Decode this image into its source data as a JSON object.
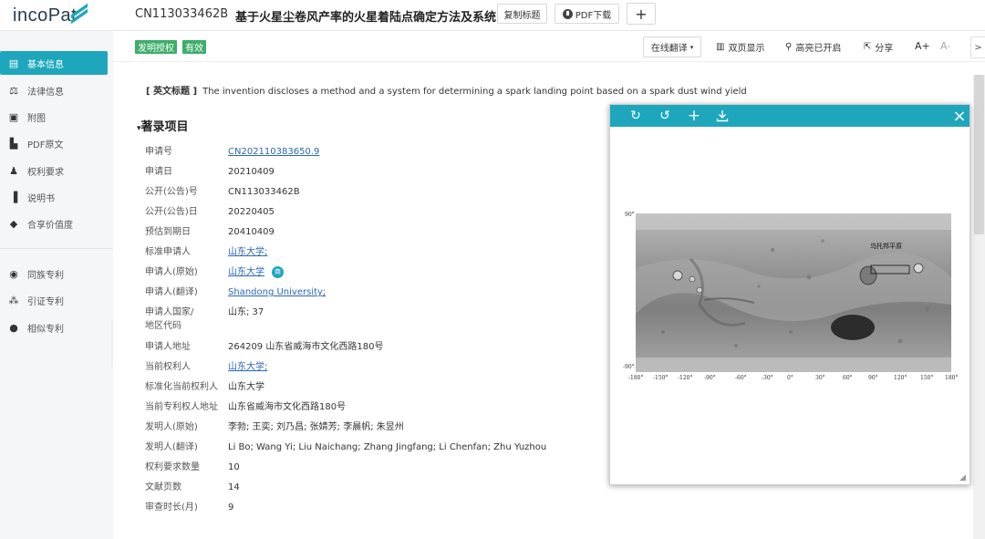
{
  "header": {
    "logo": "incoPat",
    "doc_id": "CN113033462B",
    "title": "基于火星尘卷风产率的火星着陆点确定方法及系统",
    "copy_title_label": "复制标题",
    "pdf_download_label": "PDF下载",
    "add_label": "+"
  },
  "sidebar": {
    "items": [
      {
        "label": "基本信息",
        "icon": "document-icon"
      },
      {
        "label": "法律信息",
        "icon": "scale-icon"
      },
      {
        "label": "附图",
        "icon": "image-icon"
      },
      {
        "label": "PDF原文",
        "icon": "pdf-icon"
      },
      {
        "label": "权利要求",
        "icon": "stamp-icon"
      },
      {
        "label": "说明书",
        "icon": "book-icon"
      },
      {
        "label": "合享价值度",
        "icon": "diamond-icon"
      },
      {
        "label": "同族专利",
        "icon": "family-icon"
      },
      {
        "label": "引证专利",
        "icon": "citation-icon"
      },
      {
        "label": "相似专利",
        "icon": "similar-icon"
      }
    ]
  },
  "toolbar": {
    "badge_grant": "发明授权",
    "badge_valid": "有效",
    "translate_label": "在线翻译",
    "dual_page_label": "双页显示",
    "highlight_label": "高亮已开启",
    "share_label": "分享",
    "font_up": "A+",
    "font_down": "A-",
    "edge": ">"
  },
  "english_title": {
    "label": "[ 英文标题 ]",
    "value": "The invention discloses a method and a system for determining a spark landing point based on a spark dust wind yield"
  },
  "section_title": "著录项目",
  "bibliographic": [
    {
      "label": "申请号",
      "value": "CN202110383650.9",
      "link": true
    },
    {
      "label": "申请日",
      "value": "20210409"
    },
    {
      "label": "公开(公告)号",
      "value": "CN113033462B"
    },
    {
      "label": "公开(公告)日",
      "value": "20220405"
    },
    {
      "label": "预估到期日",
      "value": "20410409"
    },
    {
      "label": "标准申请人",
      "value": "山东大学;",
      "link": true
    },
    {
      "label": "申请人(原始)",
      "value": "山东大学",
      "link": true,
      "tag": "商"
    },
    {
      "label": "申请人(翻译)",
      "value": "Shandong University;",
      "link": true
    },
    {
      "label": "申请人国家/地区代码",
      "value": "山东; 37"
    },
    {
      "label": "申请人地址",
      "value": "264209 山东省威海市文化西路180号"
    },
    {
      "label": "当前权利人",
      "value": "山东大学;",
      "link": true
    },
    {
      "label": "标准化当前权利人",
      "value": "山东大学"
    },
    {
      "label": "当前专利权人地址",
      "value": "山东省威海市文化西路180号"
    },
    {
      "label": "发明人(原始)",
      "value": "李勃; 王奕; 刘乃昌; 张婧芳; 李晨帆; 朱昱州"
    },
    {
      "label": "发明人(翻译)",
      "value": "Li Bo; Wang Yi; Liu Naichang; Zhang Jingfang; Li Chenfan; Zhu Yuzhou"
    },
    {
      "label": "权利要求数量",
      "value": "10"
    },
    {
      "label": "文献页数",
      "value": "14"
    },
    {
      "label": "审查时长(月)",
      "value": "9"
    }
  ],
  "viewer": {
    "tools": [
      "rotate-right-icon",
      "rotate-left-icon",
      "zoom-in-icon",
      "download-icon"
    ],
    "close": "×",
    "map_label": "乌托邦平原",
    "y_top": "90°",
    "y_bottom": "-90°",
    "x_ticks": [
      "-180°",
      "-150°",
      "-120°",
      "-90°",
      "-60°",
      "-30°",
      "0°",
      "30°",
      "60°",
      "90°",
      "120°",
      "150°",
      "180°"
    ]
  }
}
